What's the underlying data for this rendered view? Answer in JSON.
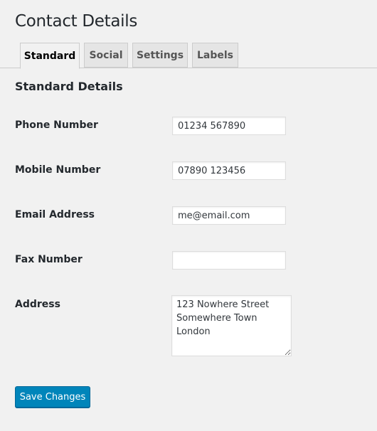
{
  "page": {
    "title": "Contact Details"
  },
  "tabs": [
    {
      "label": "Standard",
      "active": true
    },
    {
      "label": "Social",
      "active": false
    },
    {
      "label": "Settings",
      "active": false
    },
    {
      "label": "Labels",
      "active": false
    }
  ],
  "section": {
    "title": "Standard Details"
  },
  "fields": {
    "phone": {
      "label": "Phone Number",
      "value": "01234 567890"
    },
    "mobile": {
      "label": "Mobile Number",
      "value": "07890 123456"
    },
    "email": {
      "label": "Email Address",
      "value": "me@email.com"
    },
    "fax": {
      "label": "Fax Number",
      "value": ""
    },
    "address": {
      "label": "Address",
      "value": "123 Nowhere Street\nSomewhere Town\nLondon"
    }
  },
  "actions": {
    "save_label": "Save Changes"
  },
  "colors": {
    "background": "#f1f1f1",
    "primary_button": "#0085ba",
    "tab_inactive": "#e5e5e5"
  }
}
